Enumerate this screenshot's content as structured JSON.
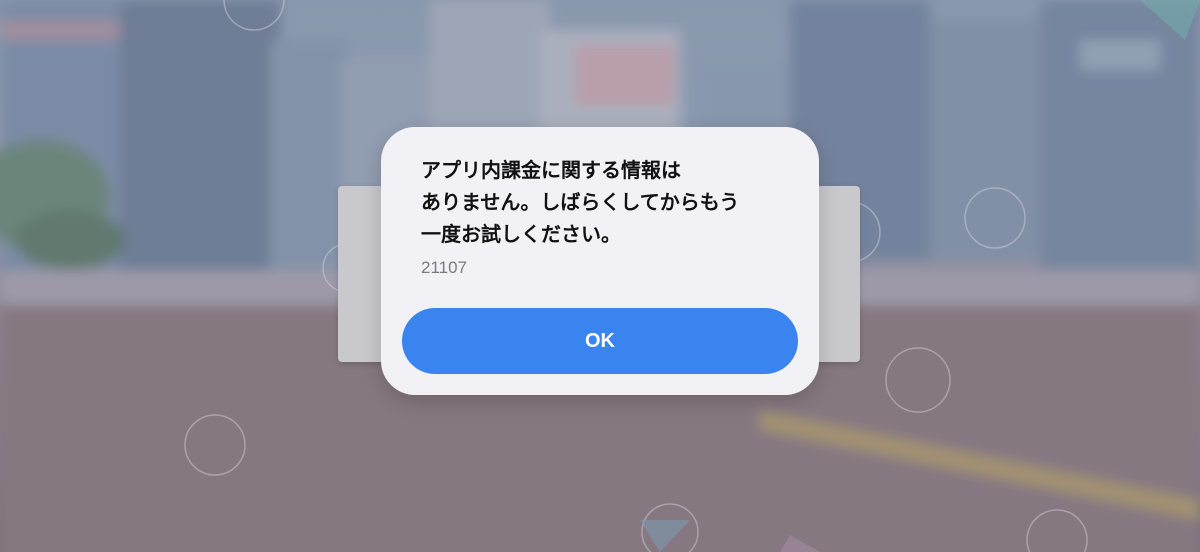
{
  "dialog": {
    "message": "アプリ内課金に関する情報は\nありません。しばらくしてからもう\n一度お試しください。",
    "error_code": "21107",
    "ok_label": "OK"
  },
  "colors": {
    "dialog_background": "#f2f2f6",
    "button_accent": "#3a84f0",
    "message_text": "#111111",
    "code_text": "#7a7a80"
  }
}
